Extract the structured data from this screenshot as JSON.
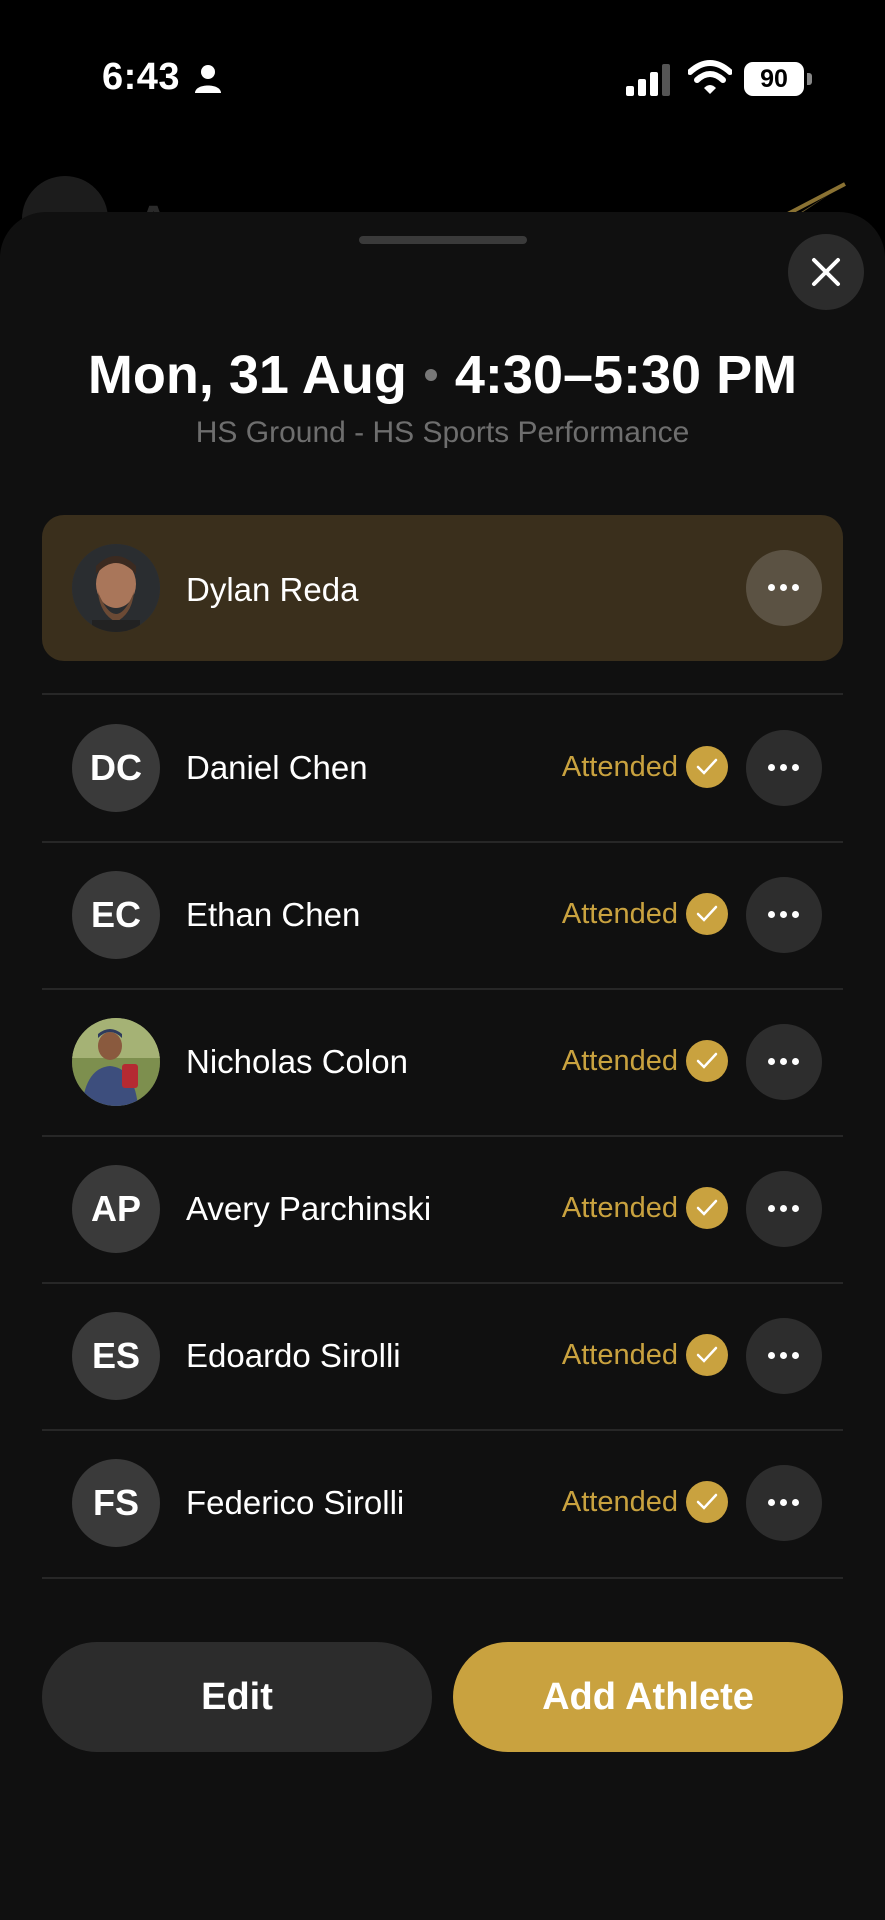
{
  "status_bar": {
    "time": "6:43",
    "battery": "90",
    "icons": [
      "person-icon",
      "signal-icon",
      "wifi-icon",
      "battery-icon"
    ]
  },
  "background": {
    "title": "Aman...",
    "icons": [
      "menu-icon",
      "logo"
    ]
  },
  "sheet": {
    "date": "Mon, 31 Aug",
    "time_range": "4:30–5:30 PM",
    "location": "HS Ground - HS Sports Performance",
    "coach": {
      "name": "Dylan Reda",
      "avatar": "photo"
    },
    "athletes": [
      {
        "initials": "DC",
        "name": "Daniel Chen",
        "status": "Attended"
      },
      {
        "initials": "EC",
        "name": "Ethan Chen",
        "status": "Attended"
      },
      {
        "initials": "",
        "name": "Nicholas Colon",
        "status": "Attended",
        "avatar": "photo"
      },
      {
        "initials": "AP",
        "name": "Avery Parchinski",
        "status": "Attended"
      },
      {
        "initials": "ES",
        "name": "Edoardo Sirolli",
        "status": "Attended"
      },
      {
        "initials": "FS",
        "name": "Federico Sirolli",
        "status": "Attended"
      }
    ],
    "edit_label": "Edit",
    "add_label": "Add Athlete"
  },
  "colors": {
    "accent": "#c9a23f",
    "sheet_bg": "#101010",
    "coach_card_bg": "#3a2f1c",
    "button_bg": "#2c2c2c"
  }
}
